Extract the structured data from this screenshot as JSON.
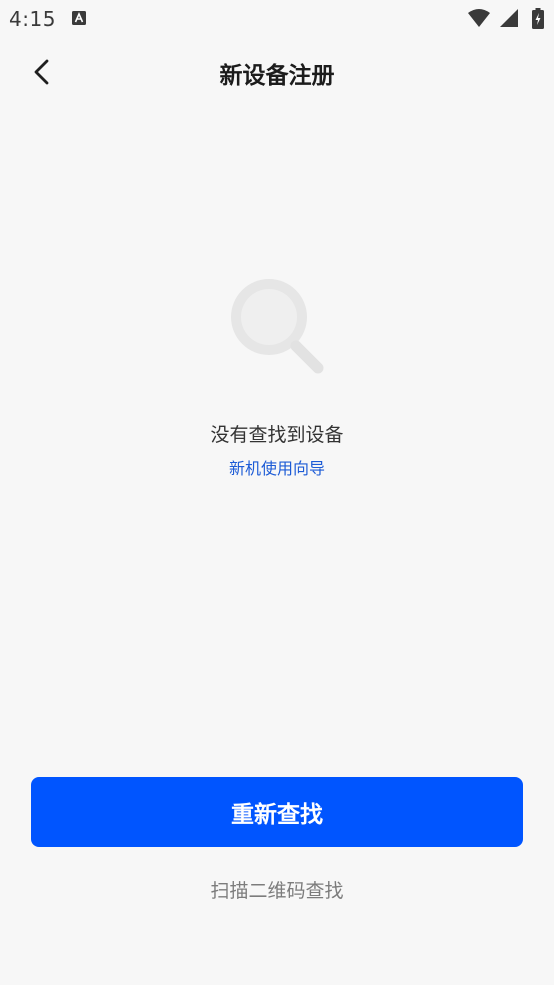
{
  "status_bar": {
    "time": "4:15",
    "icons": [
      "a-notification-icon",
      "wifi-icon",
      "signal-icon",
      "battery-icon"
    ]
  },
  "header": {
    "back_icon": "chevron-left-icon",
    "title": "新设备注册"
  },
  "empty_state": {
    "illustration_icon": "magnifier-icon",
    "message": "没有查找到设备",
    "guide_link": "新机使用向导"
  },
  "actions": {
    "retry_label": "重新查找",
    "scan_label": "扫描二维码查找"
  },
  "colors": {
    "background": "#f7f7f7",
    "primary": "#0055ff",
    "link": "#1c5bd6",
    "muted_text": "#7c7c7c"
  }
}
